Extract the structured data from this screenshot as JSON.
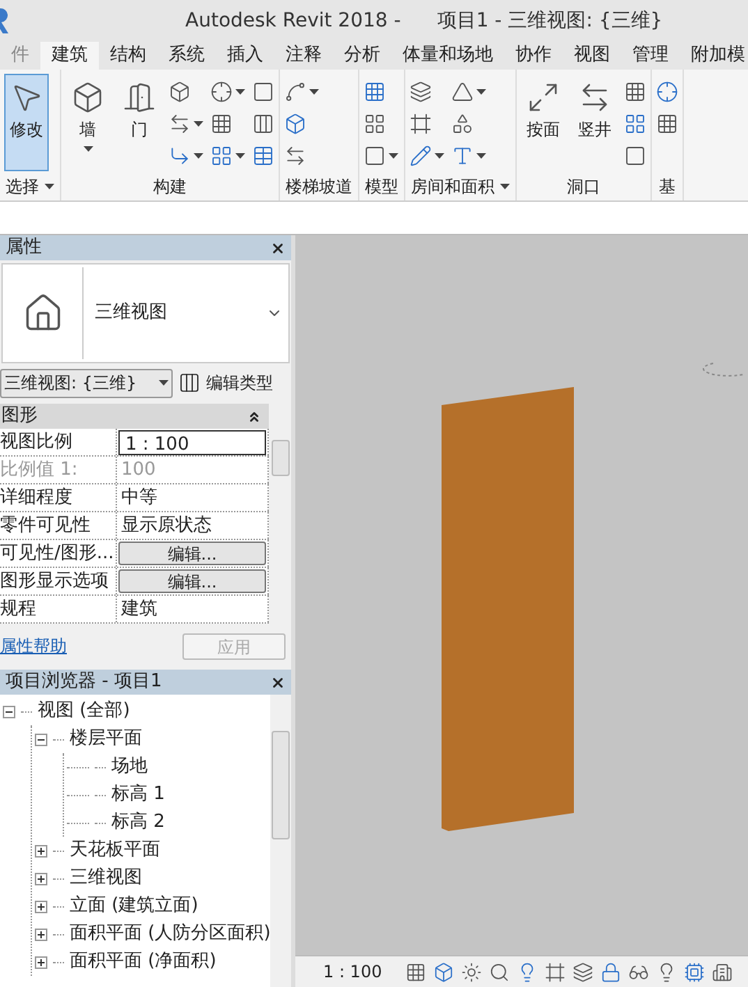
{
  "window": {
    "app_title": "Autodesk Revit 2018 -",
    "document_title": "项目1 - 三维视图: {三维}"
  },
  "ribbon_tabs": [
    {
      "label": "件",
      "selected": false
    },
    {
      "label": "建筑",
      "selected": true
    },
    {
      "label": "结构",
      "selected": false
    },
    {
      "label": "系统",
      "selected": false
    },
    {
      "label": "插入",
      "selected": false
    },
    {
      "label": "注释",
      "selected": false
    },
    {
      "label": "分析",
      "selected": false
    },
    {
      "label": "体量和场地",
      "selected": false
    },
    {
      "label": "协作",
      "selected": false
    },
    {
      "label": "视图",
      "selected": false
    },
    {
      "label": "管理",
      "selected": false
    },
    {
      "label": "附加模",
      "selected": false
    }
  ],
  "ribbon_panels": [
    {
      "label": "选择",
      "dropdown": true,
      "tools": [
        {
          "kind": "large",
          "label": "修改",
          "selected": true
        }
      ]
    },
    {
      "label": "构建",
      "dropdown": false,
      "tools": [
        {
          "kind": "large",
          "label": "墙",
          "selected": false,
          "dropdown": true
        },
        {
          "kind": "large",
          "label": "门",
          "selected": false,
          "dropdown": false
        },
        {
          "kind": "small",
          "dropdowns": [
            false,
            true,
            true
          ]
        },
        {
          "kind": "small",
          "dropdowns": [
            true,
            false,
            true
          ]
        },
        {
          "kind": "small",
          "dropdowns": [
            false,
            false,
            false
          ]
        }
      ]
    },
    {
      "label": "楼梯坡道",
      "dropdown": false,
      "tools": [
        {
          "kind": "small",
          "dropdowns": [
            true,
            false,
            false
          ]
        }
      ]
    },
    {
      "label": "模型",
      "dropdown": false,
      "tools": [
        {
          "kind": "small",
          "dropdowns": [
            false,
            false,
            true
          ]
        }
      ]
    },
    {
      "label": "房间和面积",
      "dropdown": true,
      "tools": [
        {
          "kind": "small",
          "dropdowns": [
            false,
            false,
            true
          ]
        },
        {
          "kind": "small",
          "dropdowns": [
            true,
            false,
            true
          ]
        }
      ]
    },
    {
      "label": "洞口",
      "dropdown": false,
      "tools": [
        {
          "kind": "large",
          "label": "按面",
          "selected": false,
          "dropdown": false
        },
        {
          "kind": "large",
          "label": "竖井",
          "selected": false,
          "dropdown": false
        },
        {
          "kind": "small",
          "dropdowns": [
            false,
            false,
            false
          ]
        }
      ]
    },
    {
      "label": "基",
      "dropdown": false,
      "tools": [
        {
          "kind": "small",
          "dropdowns": [
            false,
            false
          ]
        }
      ]
    }
  ],
  "properties": {
    "title": "属性",
    "type_name": "三维视图",
    "instance_selector": "三维视图: {三维}",
    "edit_type": "编辑类型",
    "group": "图形",
    "rows": [
      {
        "label": "视图比例",
        "value": "1 : 100",
        "kind": "field",
        "disabled": false
      },
      {
        "label": "比例值 1:",
        "value": "100",
        "kind": "text",
        "disabled": true
      },
      {
        "label": "详细程度",
        "value": "中等",
        "kind": "text",
        "disabled": false
      },
      {
        "label": "零件可见性",
        "value": "显示原状态",
        "kind": "text",
        "disabled": false
      },
      {
        "label": "可见性/图形...",
        "value": "编辑...",
        "kind": "button",
        "disabled": false
      },
      {
        "label": "图形显示选项",
        "value": "编辑...",
        "kind": "button",
        "disabled": false
      },
      {
        "label": "规程",
        "value": "建筑",
        "kind": "text",
        "disabled": false
      }
    ],
    "help_link": "属性帮助",
    "apply_button": "应用"
  },
  "project_browser": {
    "title": "项目浏览器 - 项目1",
    "tree": [
      {
        "label": "视图 (全部)",
        "expanded": true,
        "children": [
          {
            "label": "楼层平面",
            "expanded": true,
            "children": [
              {
                "label": "场地"
              },
              {
                "label": "标高 1"
              },
              {
                "label": "标高 2"
              }
            ]
          },
          {
            "label": "天花板平面",
            "expanded": false
          },
          {
            "label": "三维视图",
            "expanded": false
          },
          {
            "label": "立面 (建筑立面)",
            "expanded": false
          },
          {
            "label": "面积平面 (人防分区面积)",
            "expanded": false
          },
          {
            "label": "面积平面 (净面积)",
            "expanded": false
          }
        ]
      }
    ]
  },
  "status_bar": {
    "scale": "1 : 100"
  }
}
